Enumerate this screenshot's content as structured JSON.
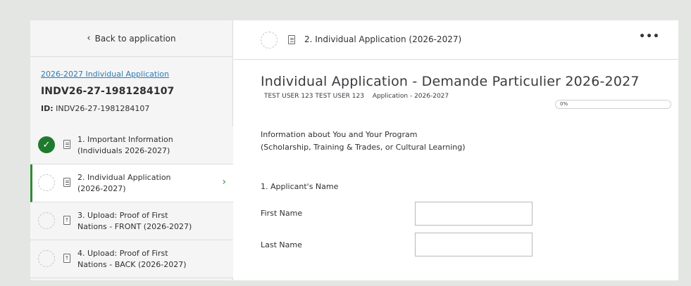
{
  "sidebar": {
    "back_label": "Back to application",
    "app_link": "2026-2027 Individual Application",
    "app_code": "INDV26-27-1981284107",
    "id_prefix": "ID:",
    "id_value": "INDV26-27-1981284107",
    "steps": [
      {
        "line1": "1. Important Information",
        "line2": "(Individuals 2026-2027)",
        "status": "complete",
        "type": "document"
      },
      {
        "line1": "2. Individual Application",
        "line2": "(2026-2027)",
        "status": "incomplete",
        "type": "document"
      },
      {
        "line1": "3. Upload: Proof of First",
        "line2": "Nations - FRONT (2026-2027)",
        "status": "incomplete",
        "type": "upload"
      },
      {
        "line1": "4. Upload: Proof of First",
        "line2": "Nations - BACK (2026-2027)",
        "status": "incomplete",
        "type": "upload"
      }
    ]
  },
  "header": {
    "title": "2. Individual Application (2026-2027)",
    "more_label": "•••"
  },
  "form": {
    "title": "Individual Application - Demande Particulier 2026-2027",
    "user_name": "TEST USER 123 TEST USER 123",
    "app_label": "Application - 2026-2027",
    "progress_label": "0%",
    "progress_value": 0,
    "info_line1": "Information about You and Your Program",
    "info_line2": "(Scholarship, Training & Trades, or Cultural Learning)",
    "section_title": "1. Applicant's Name",
    "first_name_label": "First Name",
    "first_name_value": "",
    "last_name_label": "Last Name",
    "last_name_value": ""
  },
  "colors": {
    "accent_green": "#2f8a34",
    "link_blue": "#2b7bb5",
    "complete_green": "#1f7a2e"
  }
}
